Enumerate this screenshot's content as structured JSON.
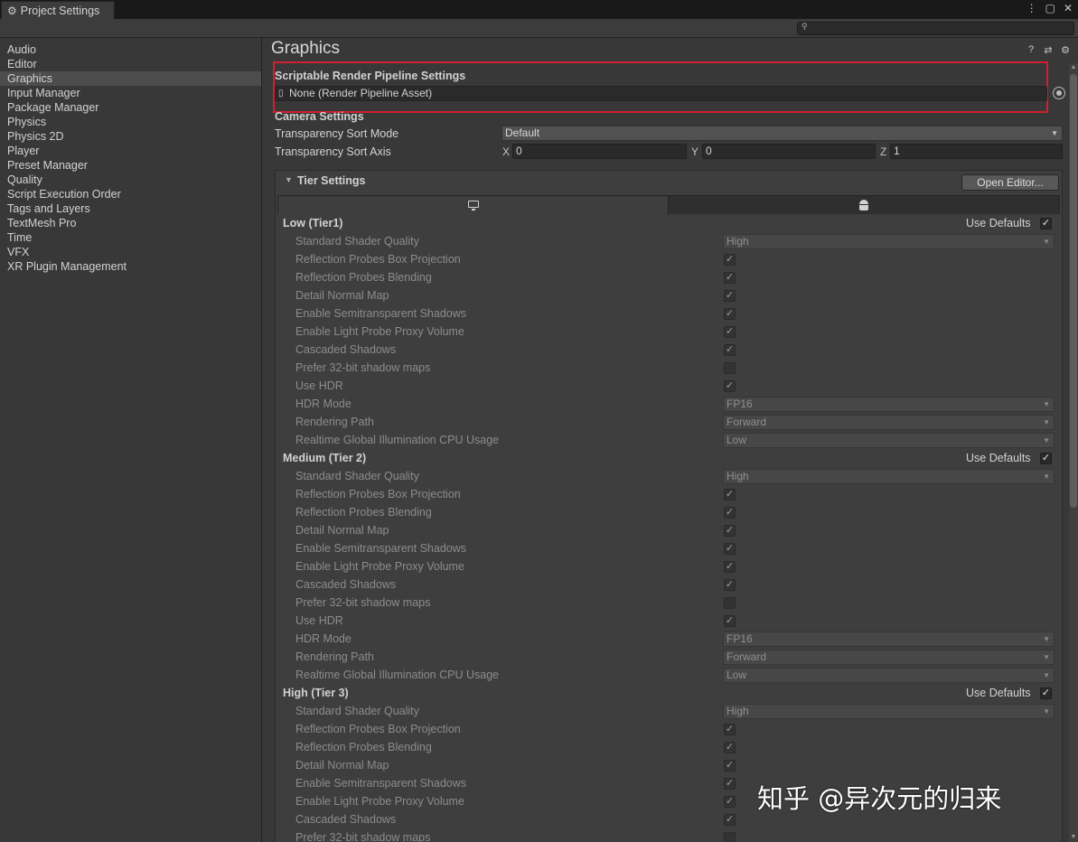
{
  "window": {
    "tab_title": "Project Settings",
    "menu_icon": "kebab-menu-icon",
    "maximize_icon": "maximize-icon",
    "close_icon": "close-icon"
  },
  "search": {
    "value": "",
    "placeholder": ""
  },
  "sidebar": {
    "active": "Graphics",
    "items": [
      "Audio",
      "Editor",
      "Graphics",
      "Input Manager",
      "Package Manager",
      "Physics",
      "Physics 2D",
      "Player",
      "Preset Manager",
      "Quality",
      "Script Execution Order",
      "Tags and Layers",
      "TextMesh Pro",
      "Time",
      "VFX",
      "XR Plugin Management"
    ]
  },
  "page": {
    "title": "Graphics",
    "icons": [
      "help-icon",
      "presets-icon",
      "settings-gear-icon"
    ]
  },
  "srp": {
    "section": "Scriptable Render Pipeline Settings",
    "value": "None (Render Pipeline Asset)"
  },
  "camera": {
    "section": "Camera Settings",
    "sort_mode_label": "Transparency Sort Mode",
    "sort_mode_value": "Default",
    "sort_axis_label": "Transparency Sort Axis",
    "x_label": "X",
    "x": "0",
    "y_label": "Y",
    "y": "0",
    "z_label": "Z",
    "z": "1"
  },
  "tier_settings": {
    "title": "Tier Settings",
    "open_editor": "Open Editor...",
    "platform_tabs": [
      "standalone-monitor-icon",
      "android-icon"
    ],
    "use_defaults_label": "Use Defaults",
    "tiers": [
      {
        "name": "Low (Tier1)",
        "use_defaults": true,
        "settings": [
          {
            "label": "Standard Shader Quality",
            "type": "dropdown",
            "value": "High"
          },
          {
            "label": "Reflection Probes Box Projection",
            "type": "check",
            "checked": true
          },
          {
            "label": "Reflection Probes Blending",
            "type": "check",
            "checked": true
          },
          {
            "label": "Detail Normal Map",
            "type": "check",
            "checked": true
          },
          {
            "label": "Enable Semitransparent Shadows",
            "type": "check",
            "checked": true
          },
          {
            "label": "Enable Light Probe Proxy Volume",
            "type": "check",
            "checked": true
          },
          {
            "label": "Cascaded Shadows",
            "type": "check",
            "checked": true
          },
          {
            "label": "Prefer 32-bit shadow maps",
            "type": "check",
            "checked": false
          },
          {
            "label": "Use HDR",
            "type": "check",
            "checked": true
          },
          {
            "label": "HDR Mode",
            "type": "dropdown",
            "value": "FP16"
          },
          {
            "label": "Rendering Path",
            "type": "dropdown",
            "value": "Forward"
          },
          {
            "label": "Realtime Global Illumination CPU Usage",
            "type": "dropdown",
            "value": "Low"
          }
        ]
      },
      {
        "name": "Medium (Tier 2)",
        "use_defaults": true,
        "settings": [
          {
            "label": "Standard Shader Quality",
            "type": "dropdown",
            "value": "High"
          },
          {
            "label": "Reflection Probes Box Projection",
            "type": "check",
            "checked": true
          },
          {
            "label": "Reflection Probes Blending",
            "type": "check",
            "checked": true
          },
          {
            "label": "Detail Normal Map",
            "type": "check",
            "checked": true
          },
          {
            "label": "Enable Semitransparent Shadows",
            "type": "check",
            "checked": true
          },
          {
            "label": "Enable Light Probe Proxy Volume",
            "type": "check",
            "checked": true
          },
          {
            "label": "Cascaded Shadows",
            "type": "check",
            "checked": true
          },
          {
            "label": "Prefer 32-bit shadow maps",
            "type": "check",
            "checked": false
          },
          {
            "label": "Use HDR",
            "type": "check",
            "checked": true
          },
          {
            "label": "HDR Mode",
            "type": "dropdown",
            "value": "FP16"
          },
          {
            "label": "Rendering Path",
            "type": "dropdown",
            "value": "Forward"
          },
          {
            "label": "Realtime Global Illumination CPU Usage",
            "type": "dropdown",
            "value": "Low"
          }
        ]
      },
      {
        "name": "High (Tier 3)",
        "use_defaults": true,
        "settings": [
          {
            "label": "Standard Shader Quality",
            "type": "dropdown",
            "value": "High"
          },
          {
            "label": "Reflection Probes Box Projection",
            "type": "check",
            "checked": true
          },
          {
            "label": "Reflection Probes Blending",
            "type": "check",
            "checked": true
          },
          {
            "label": "Detail Normal Map",
            "type": "check",
            "checked": true
          },
          {
            "label": "Enable Semitransparent Shadows",
            "type": "check",
            "checked": true
          },
          {
            "label": "Enable Light Probe Proxy Volume",
            "type": "check",
            "checked": true
          },
          {
            "label": "Cascaded Shadows",
            "type": "check",
            "checked": true
          },
          {
            "label": "Prefer 32-bit shadow maps",
            "type": "check",
            "checked": false
          }
        ]
      }
    ]
  },
  "watermark": "知乎 @异次元的归来",
  "colors": {
    "highlight": "#d11f2f",
    "panel": "#383838",
    "field": "#2a2a2a"
  }
}
